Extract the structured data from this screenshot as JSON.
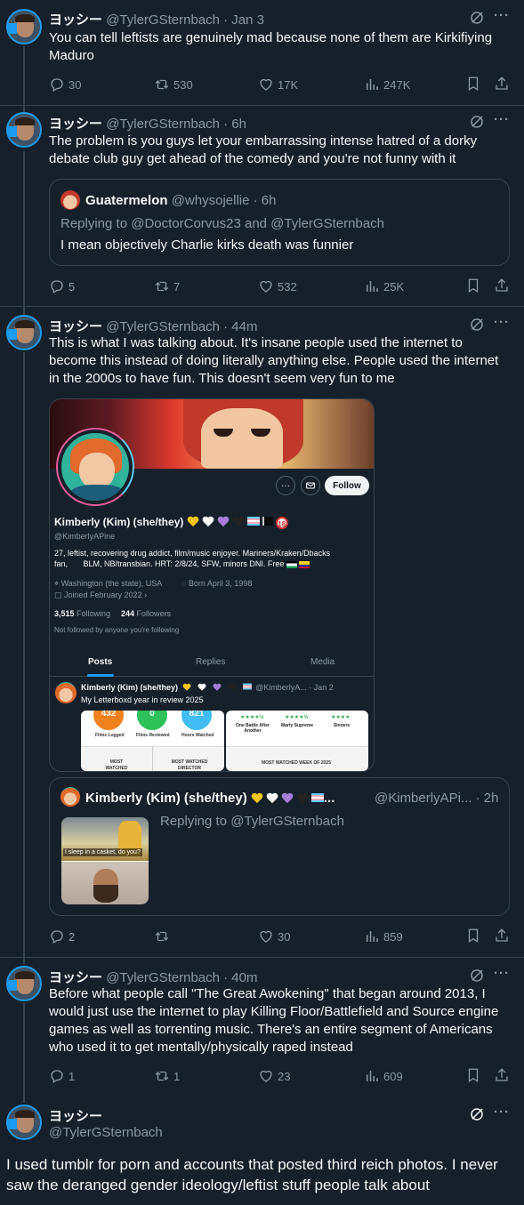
{
  "tweets": [
    {
      "name": "ヨッシー",
      "handle": "@TylerGSternbach",
      "time": "· Jan 3",
      "text": "You can tell leftists are genuinely mad because none of them are Kirkifiying Maduro",
      "replies": "30",
      "retweets": "530",
      "likes": "17K",
      "views": "247K"
    },
    {
      "name": "ヨッシー",
      "handle": "@TylerGSternbach",
      "time": "· 6h",
      "text": "The problem is you guys let your embarrassing intense hatred of a dorky debate club guy get ahead of the comedy and you're not funny with it",
      "quote": {
        "name": "Guatermelon",
        "handle": "@whysojellie",
        "time": "· 6h",
        "replying": "Replying to @DoctorCorvus23 and @TylerGSternbach",
        "text": "I mean objectively Charlie kirks death was funnier"
      },
      "replies": "5",
      "retweets": "7",
      "likes": "532",
      "views": "25K"
    },
    {
      "name": "ヨッシー",
      "handle": "@TylerGSternbach",
      "time": "· 44m",
      "text": "This is what I was talking about. It's insane people used the internet to become this instead of doing literally anything else. People used the internet in the 2000s to have fun. This doesn't seem very fun to me",
      "screenshot": {
        "follow_label": "Follow",
        "display_name": "Kimberly (Kim) (she/they)",
        "age_badge": "18",
        "handle": "@KimberlyAPine",
        "bio_line1": "27, leftist, recovering drug addict, film/music enjoyer. Mariners/Kraken/Dbacks",
        "bio_line2": "fan,       BLM, NB/transbian. HRT: 2/8/24, SFW, minors DNI. Free",
        "location": "Washington (the state), USA",
        "born": "Born April 3, 1998",
        "joined": "Joined February 2022",
        "following_count": "3,515",
        "following_label": "Following",
        "followers_count": "244",
        "followers_label": "Followers",
        "not_followed": "Not followed by anyone you're following",
        "tabs": [
          "Posts",
          "Replies",
          "Media"
        ],
        "post_name": "Kimberly (Kim) (she/they)",
        "post_handle": "@KimberlyA...",
        "post_time": "· Jan 2",
        "post_text": "My Letterboxd year in review 2025",
        "stats": [
          {
            "value": "432",
            "label": "Films Logged"
          },
          {
            "value": "0",
            "label": "Films Reviewed"
          },
          {
            "value": "821",
            "label": "Hours Watched"
          }
        ],
        "most_watched_actor": "MOST WATCHED ACTOR",
        "most_watched_director": "MOST WATCHED DIRECTOR",
        "rated": [
          {
            "stars": "★★★★½",
            "title": "One Battle After Another"
          },
          {
            "stars": "★★★★½",
            "title": "Marty Supreme"
          },
          {
            "stars": "★★★★",
            "title": "Sinners"
          }
        ],
        "most_watched_week": "MOST WATCHED WEEK OF 2025"
      },
      "quote": {
        "name": "Kimberly (Kim) (she/they)",
        "handle": "@KimberlyAPi...",
        "time": "· 2h",
        "replying": "Replying to @TylerGSternbach",
        "media_caption": "I sleep in a casket, do you?"
      },
      "replies": "2",
      "retweets": "",
      "likes": "30",
      "views": "859"
    },
    {
      "name": "ヨッシー",
      "handle": "@TylerGSternbach",
      "time": "· 40m",
      "text": "Before what people call \"The Great Awokening\" that began around 2013, I would just use the internet to play Killing Floor/Battlefield and Source engine games as well as torrenting music. There's an entire segment of Americans who used it to get mentally/physically raped instead",
      "replies": "1",
      "retweets": "1",
      "likes": "23",
      "views": "609"
    }
  ],
  "focus": {
    "name": "ヨッシー",
    "handle": "@TylerGSternbach",
    "text": "I used tumblr for porn and accounts that posted third reich photos. I never saw the deranged gender ideology/leftist stuff people talk about"
  },
  "icons": {
    "reply": "reply-icon",
    "retweet": "retweet-icon",
    "like": "heart-icon",
    "views": "views-icon",
    "bookmark": "bookmark-icon",
    "share": "share-icon",
    "grok": "grok-icon",
    "more": "more-icon"
  },
  "colors": {
    "background": "#15202b",
    "text": "#f7f9f9",
    "muted": "#8b98a5",
    "border": "#38444d",
    "accent": "#1d9bf0"
  }
}
